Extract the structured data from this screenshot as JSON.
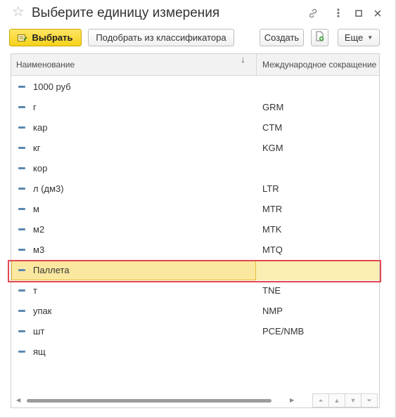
{
  "window": {
    "title": "Выберите единицу измерения",
    "icons": [
      "star-icon",
      "link-icon",
      "more-icon",
      "maximize-icon",
      "close-icon"
    ]
  },
  "toolbar": {
    "select_label": "Выбрать",
    "classifier_label": "Подобрать из классификатора",
    "create_label": "Создать",
    "more_label": "Еще",
    "doc_icon": "new-document-icon"
  },
  "grid": {
    "columns": [
      "Наименование",
      "Международное сокращение"
    ],
    "sort": "descending-arrow",
    "rows": [
      {
        "name": "1000 руб",
        "abbr": ""
      },
      {
        "name": "г",
        "abbr": "GRM"
      },
      {
        "name": "кар",
        "abbr": "CTM"
      },
      {
        "name": "кг",
        "abbr": "KGM"
      },
      {
        "name": "кор",
        "abbr": ""
      },
      {
        "name": "л (дм3)",
        "abbr": "LTR"
      },
      {
        "name": "м",
        "abbr": "MTR"
      },
      {
        "name": "м2",
        "abbr": "MTK"
      },
      {
        "name": "м3",
        "abbr": "MTQ"
      },
      {
        "name": "Паллета",
        "abbr": ""
      },
      {
        "name": "т",
        "abbr": "TNE"
      },
      {
        "name": "упак",
        "abbr": "NMP"
      },
      {
        "name": "шт",
        "abbr": "PCE/NMB"
      },
      {
        "name": "ящ",
        "abbr": ""
      }
    ],
    "selected_row": 9
  },
  "colors": {
    "accent_button": "#f5d21a",
    "selection": "#fbe8a0",
    "highlight_frame": "#e0484f"
  }
}
